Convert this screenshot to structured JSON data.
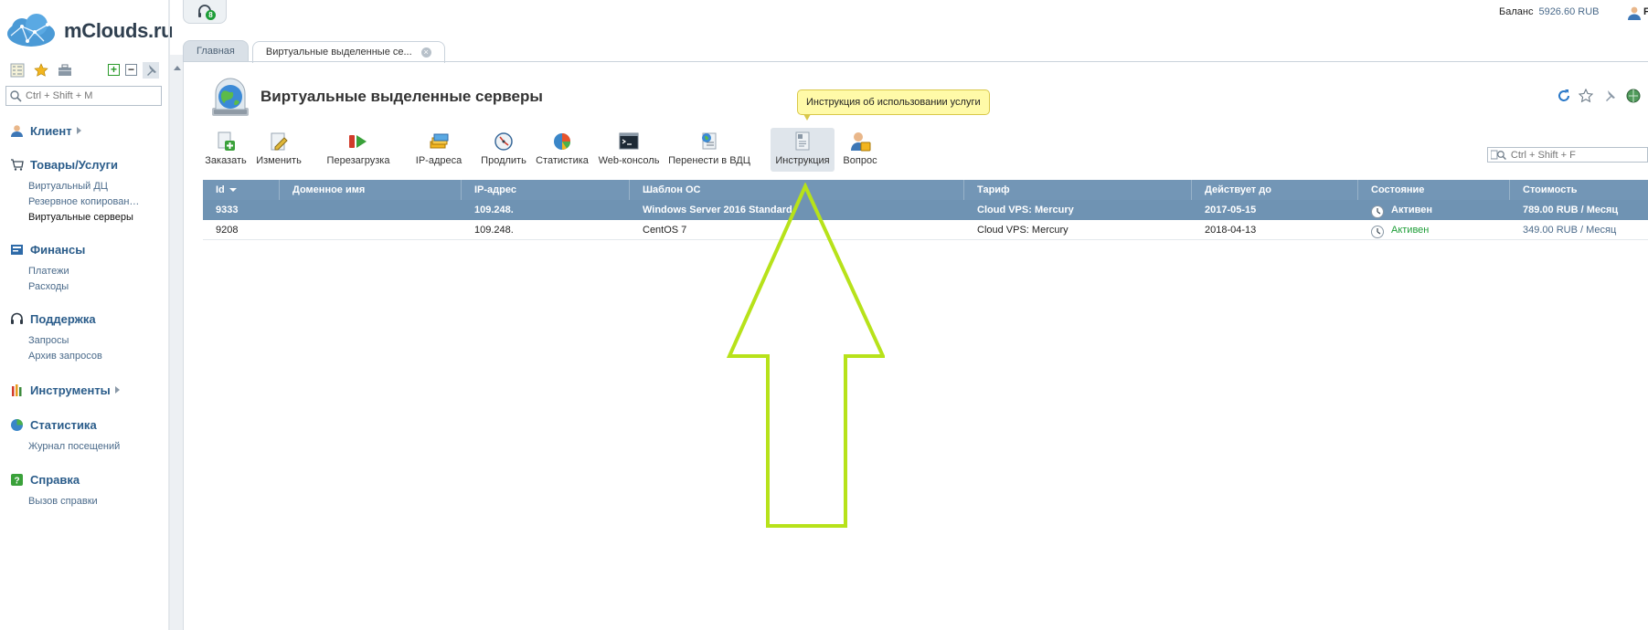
{
  "brand": {
    "name": "mClouds.ru"
  },
  "header": {
    "support_badge": "8",
    "balance_label": "Баланс",
    "balance_value": "5926.60 RUB",
    "user_letter": "F"
  },
  "sidebar": {
    "search_placeholder": "Ctrl + Shift + M",
    "groups": [
      {
        "label": "Клиент",
        "icon": "client-icon",
        "items": []
      },
      {
        "label": "Товары/Услуги",
        "icon": "cart-icon",
        "items": [
          "Виртуальный ДЦ",
          "Резервное копирован…",
          "Виртуальные серверы"
        ]
      },
      {
        "label": "Финансы",
        "icon": "finance-icon",
        "items": [
          "Платежи",
          "Расходы"
        ]
      },
      {
        "label": "Поддержка",
        "icon": "headset-icon",
        "items": [
          "Запросы",
          "Архив запросов"
        ]
      },
      {
        "label": "Инструменты",
        "icon": "tools-icon",
        "items": []
      },
      {
        "label": "Статистика",
        "icon": "stats-icon",
        "items": [
          "Журнал посещений"
        ]
      },
      {
        "label": "Справка",
        "icon": "help-icon",
        "items": [
          "Вызов справки"
        ]
      }
    ]
  },
  "tabs": [
    {
      "label": "Главная"
    },
    {
      "label": "Виртуальные выделенные се..."
    }
  ],
  "main": {
    "title": "Виртуальные выделенные серверы",
    "tooltip": "Инструкция об использовании услуги",
    "grid_search_placeholder": "Ctrl + Shift + F",
    "toolbar": [
      {
        "label": "Заказать",
        "icon": "order-icon"
      },
      {
        "label": "Изменить",
        "icon": "edit-icon"
      },
      {
        "label": "Перезагрузка",
        "icon": "reboot-icon"
      },
      {
        "label": "IP-адреса",
        "icon": "ip-addresses-icon"
      },
      {
        "label": "Продлить",
        "icon": "renew-icon"
      },
      {
        "label": "Статистика",
        "icon": "statistics-icon"
      },
      {
        "label": "Web-консоль",
        "icon": "console-icon"
      },
      {
        "label": "Перенести в ВДЦ",
        "icon": "migrate-icon"
      },
      {
        "label": "Инструкция",
        "icon": "instruction-icon"
      },
      {
        "label": "Вопрос",
        "icon": "question-icon"
      }
    ],
    "table": {
      "columns": [
        "Id",
        "Доменное имя",
        "IP-адрес",
        "Шаблон ОС",
        "Тариф",
        "Действует до",
        "Состояние",
        "Стоимость"
      ],
      "rows": [
        {
          "id": "9333",
          "domain": "",
          "ip": "109.248.",
          "os": "Windows Server 2016 Standard",
          "tariff": "Cloud VPS: Mercury",
          "until": "2017-05-15",
          "status": "Активен",
          "cost": "789.00 RUB / Месяц"
        },
        {
          "id": "9208",
          "domain": "",
          "ip": "109.248.",
          "os": "CentOS 7",
          "tariff": "Cloud VPS: Mercury",
          "until": "2018-04-13",
          "status": "Активен",
          "cost": "349.00 RUB / Месяц"
        }
      ]
    }
  },
  "colors": {
    "header_blue": "#7396b6",
    "selected_row": "#6f93b3",
    "arrow": "#b7e21a",
    "active_green": "#1e9e38"
  }
}
